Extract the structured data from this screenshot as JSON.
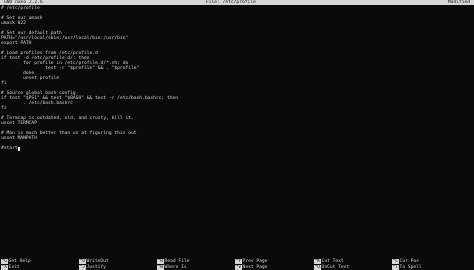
{
  "titlebar": {
    "app": "GNU nano 2.2.6",
    "file": "File: /etc/profile",
    "state": "Modified"
  },
  "editor": {
    "lines": [
      "# /etc/profile",
      "",
      "# Set our umask",
      "umask 022",
      "",
      "# Set our default path",
      "PATH=\"/usr/local/sbin:/usr/local/bin:/usr/bin\"",
      "export PATH",
      "",
      "# Load profiles from /etc/profile.d",
      "if test -d /etc/profile.d/; then",
      "        for profile in /etc/profile.d/*.sh; do",
      "                test -r \"$profile\" && . \"$profile\"",
      "        done",
      "        unset profile",
      "fi",
      "",
      "# Source global bash config",
      "if test \"$PS1\" && test \"$BASH\" && test -r /etc/bash.bashrc; then",
      "        . /etc/bash.bashrc",
      "fi",
      "",
      "# Termcap is outdated, old, and crusty, kill it.",
      "unset TERMCAP",
      "",
      "# Man is much better than us at figuring this out",
      "unset MANPATH",
      "",
      "#start"
    ]
  },
  "shortcuts": [
    {
      "key": "^G",
      "label": "Get Help"
    },
    {
      "key": "^X",
      "label": "Exit"
    },
    {
      "key": "^O",
      "label": "WriteOut"
    },
    {
      "key": "^J",
      "label": "Justify"
    },
    {
      "key": "^R",
      "label": "Read File"
    },
    {
      "key": "^W",
      "label": "Where Is"
    },
    {
      "key": "^Y",
      "label": "Prev Page"
    },
    {
      "key": "^V",
      "label": "Next Page"
    },
    {
      "key": "^K",
      "label": "Cut Text"
    },
    {
      "key": "^U",
      "label": "UnCut Text"
    },
    {
      "key": "^C",
      "label": "Cur Pos"
    },
    {
      "key": "^T",
      "label": "To Spell"
    }
  ]
}
